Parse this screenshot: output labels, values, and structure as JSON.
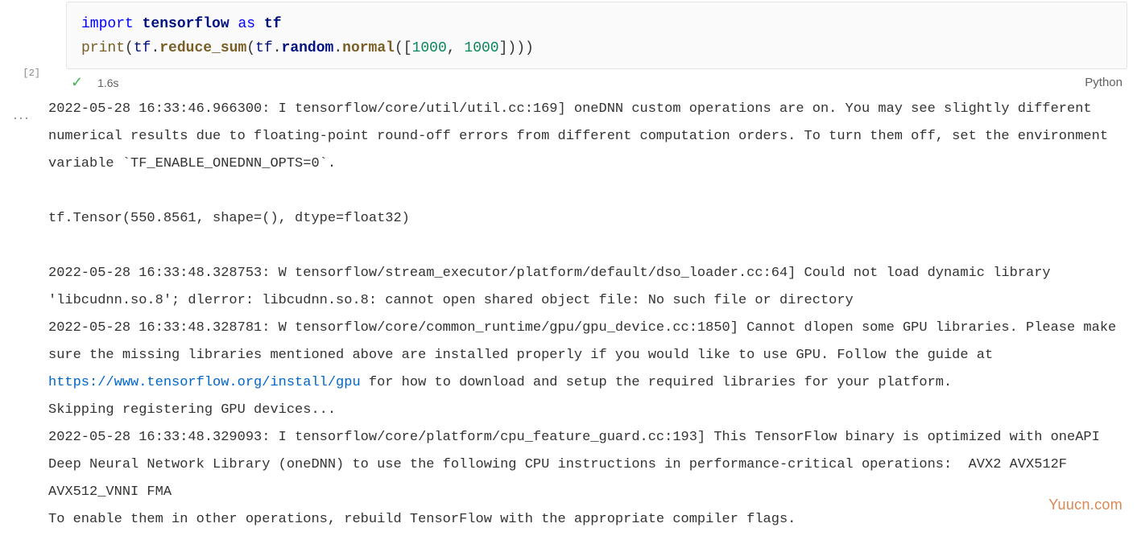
{
  "cell": {
    "exec_count": "[2]",
    "code": {
      "line1": {
        "import": "import",
        "module": "tensorflow",
        "as": "as",
        "alias": "tf"
      },
      "line2": {
        "print": "print",
        "open1": "(",
        "tf1": "tf",
        "dot1": ".",
        "reduce_sum": "reduce_sum",
        "open2": "(",
        "tf2": "tf",
        "dot2": ".",
        "random": "random",
        "dot3": ".",
        "normal": "normal",
        "open3": "([",
        "n1": "1000",
        "comma": ", ",
        "n2": "1000",
        "close3": "])))"
      }
    },
    "status": {
      "check": "✓",
      "time": "1.6s",
      "language": "Python"
    }
  },
  "output": {
    "seg1": "2022-05-28 16:33:46.966300: I tensorflow/core/util/util.cc:169] oneDNN custom operations are on. You may see slightly different numerical results due to floating-point round-off errors from different computation orders. To turn them off, set the environment variable `TF_ENABLE_ONEDNN_OPTS=0`.",
    "blank1": "",
    "seg2": "tf.Tensor(550.8561, shape=(), dtype=float32)",
    "blank2": "",
    "seg3": "2022-05-28 16:33:48.328753: W tensorflow/stream_executor/platform/default/dso_loader.cc:64] Could not load dynamic library 'libcudnn.so.8'; dlerror: libcudnn.so.8: cannot open shared object file: No such file or directory",
    "seg4a": "2022-05-28 16:33:48.328781: W tensorflow/core/common_runtime/gpu/gpu_device.cc:1850] Cannot dlopen some GPU libraries. Please make sure the missing libraries mentioned above are installed properly if you would like to use GPU. Follow the guide at ",
    "link": "https://www.tensorflow.org/install/gpu",
    "seg4b": " for how to download and setup the required libraries for your platform.",
    "seg5": "Skipping registering GPU devices...",
    "seg6": "2022-05-28 16:33:48.329093: I tensorflow/core/platform/cpu_feature_guard.cc:193] This TensorFlow binary is optimized with oneAPI Deep Neural Network Library (oneDNN) to use the following CPU instructions in performance-critical operations:  AVX2 AVX512F AVX512_VNNI FMA",
    "seg7": "To enable them in other operations, rebuild TensorFlow with the appropriate compiler flags."
  },
  "more_icon": "···",
  "watermark": "Yuucn.com"
}
